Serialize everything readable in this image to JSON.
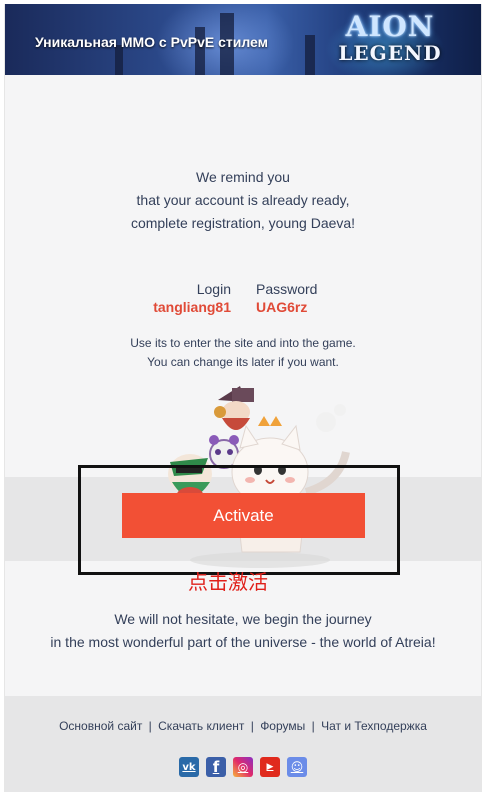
{
  "banner": {
    "tagline": "Уникальная ММО с PvPvE стилем",
    "logo_top": "AION",
    "logo_bottom": "LEGEND"
  },
  "remind": {
    "line1": "We remind you",
    "line2": "that your account is already ready,",
    "line3": "complete registration, young Daeva!"
  },
  "credentials": {
    "login_label": "Login",
    "login_value": "tangliang81",
    "password_label": "Password",
    "password_value": "UAG6rz"
  },
  "hint": {
    "line1": "Use its to enter the site and into the game.",
    "line2": "You can change its later if you want."
  },
  "activate": {
    "label": "Activate",
    "annotation": "点击激活"
  },
  "journey": {
    "line1": "We will not hesitate, we begin the journey",
    "line2": "in the most wonderful part of the universe - the world of Atreia!"
  },
  "footer": {
    "links": [
      "Основной сайт",
      "Скачать клиент",
      "Форумы",
      "Чат и Техподержка"
    ],
    "separator": "|",
    "socials": [
      {
        "name": "vk-icon",
        "glyph": "vk",
        "color": "#2a6aa8"
      },
      {
        "name": "facebook-icon",
        "glyph": "f",
        "color": "#3b5fa8"
      },
      {
        "name": "instagram-icon",
        "glyph": "◎",
        "color": "#e02a6a"
      },
      {
        "name": "youtube-icon",
        "glyph": "▶",
        "color": "#e02a1d"
      },
      {
        "name": "discord-icon",
        "glyph": "☺",
        "color": "#6b8ce8"
      }
    ]
  },
  "colors": {
    "accent_button": "#f25035",
    "credential_value": "#e04a37",
    "annotation": "#e0201a",
    "text": "#34405a"
  }
}
